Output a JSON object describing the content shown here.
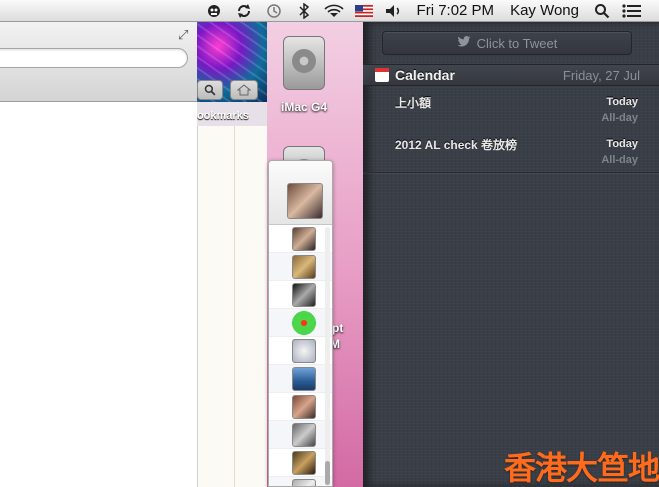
{
  "menubar": {
    "clock": "Fri 7:02 PM",
    "user": "Kay Wong",
    "icons": [
      "cloud-app-icon",
      "sync-icon",
      "time-machine-icon",
      "bluetooth-icon",
      "wifi-icon",
      "flag-us-icon",
      "volume-icon",
      "search-icon",
      "notification-center-icon"
    ]
  },
  "browser": {
    "bookmarks_label": "Bookmarks"
  },
  "desktop": {
    "drive_label": "iMac G4",
    "fragment1": "pt",
    "fragment2": "M"
  },
  "notification_center": {
    "tweet_label": "Click to Tweet",
    "calendar": {
      "title": "Calendar",
      "date": "Friday, 27 Jul",
      "events": [
        {
          "title": "上小額",
          "day": "Today",
          "time": "All-day"
        },
        {
          "title": "2012 AL check 卷放榜",
          "day": "Today",
          "time": "All-day"
        }
      ]
    }
  },
  "watermark": "香港大笪地",
  "colors": {
    "nc_background": "#3a3e46",
    "desktop_pink": "#e79cc4",
    "watermark": "#ff6b1a"
  }
}
